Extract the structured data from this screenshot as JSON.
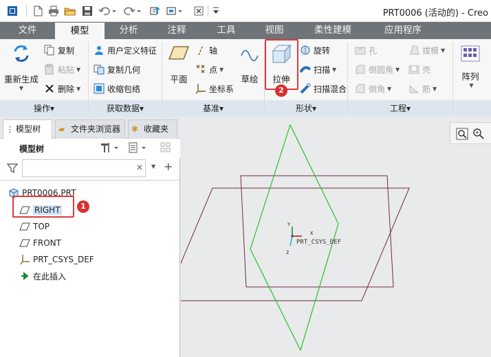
{
  "window": {
    "title": "PRT0006 (活动的) - Creo"
  },
  "quick_access": [
    "app-menu-icon",
    "new-icon",
    "open-icon",
    "save-icon",
    "undo-icon",
    "redo-icon",
    "regenerate-icon",
    "windows-icon",
    "close-window-icon"
  ],
  "tabs": [
    {
      "label": "文件",
      "active": false
    },
    {
      "label": "模型",
      "active": true
    },
    {
      "label": "分析",
      "active": false
    },
    {
      "label": "注释",
      "active": false
    },
    {
      "label": "工具",
      "active": false
    },
    {
      "label": "视图",
      "active": false
    },
    {
      "label": "柔性建模",
      "active": false
    },
    {
      "label": "应用程序",
      "active": false
    }
  ],
  "ribbon": {
    "operations": {
      "label": "操作▾",
      "regenerate": "重新生成",
      "copy": "复制",
      "paste": "粘贴",
      "delete": "删除"
    },
    "get_data": {
      "label": "获取数据▾",
      "udf": "用户定义特征",
      "copy_geom": "复制几何",
      "shrinkwrap": "收缩包络"
    },
    "datum": {
      "label": "基准▾",
      "plane": "平面",
      "axis": "轴",
      "point": "点",
      "csys": "坐标系",
      "sketch": "草绘"
    },
    "shapes": {
      "label": "形状▾",
      "extrude": "拉伸",
      "revolve": "旋转",
      "sweep": "扫描",
      "swept_blend": "扫描混合"
    },
    "engineering": {
      "label": "工程▾",
      "hole": "孔",
      "draft": "拔模",
      "round": "倒圆角",
      "shell": "壳",
      "chamfer": "倒角",
      "rib": "筋"
    },
    "pattern": {
      "label": "阵列"
    }
  },
  "left_panel": {
    "tabs": [
      "模型树",
      "文件夹浏览器",
      "收藏夹"
    ],
    "toolbar_title": "模型树",
    "filter_placeholder": "",
    "tree": [
      {
        "label": "PRT0006.PRT",
        "icon": "part-icon"
      },
      {
        "label": "RIGHT",
        "icon": "datum-plane-icon",
        "selected": true
      },
      {
        "label": "TOP",
        "icon": "datum-plane-icon"
      },
      {
        "label": "FRONT",
        "icon": "datum-plane-icon"
      },
      {
        "label": "PRT_CSYS_DEF",
        "icon": "csys-icon"
      },
      {
        "label": "在此插入",
        "icon": "insert-arrow-icon"
      }
    ]
  },
  "viewport": {
    "csys_label": "PRT_CSYS_DEF",
    "axes": {
      "x": "X",
      "y": "Y",
      "z": "Z"
    }
  },
  "annotations": {
    "badge1": "1",
    "badge2": "2"
  },
  "colors": {
    "tab_bar": "#6f7479",
    "ribbon_bg": "#f7f7f7",
    "highlight_red": "#e03a3a",
    "right_plane": "#26c226",
    "other_planes": "#6e2a3a",
    "selection": "#cfe3f7"
  }
}
